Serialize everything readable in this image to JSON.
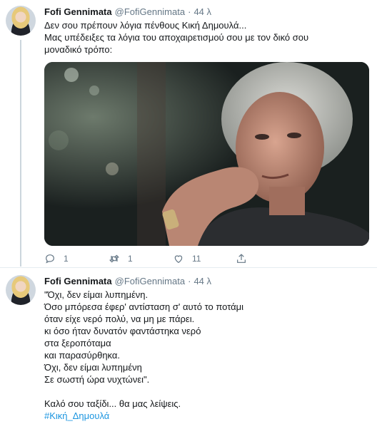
{
  "tweets": [
    {
      "author_name": "Fofi Gennimata",
      "handle": "@FofiGennimata",
      "separator": "·",
      "time": "44 λ",
      "text_lines": [
        "Δεν σου πρέπουν λόγια πένθους Κική Δημουλά...",
        "Μας υπέδειξες τα λόγια του αποχαιρετισμού σου με τον δικό σου",
        "μοναδικό τρόπο:"
      ],
      "actions": {
        "reply_count": "1",
        "retweet_count": "1",
        "like_count": "11"
      }
    },
    {
      "author_name": "Fofi Gennimata",
      "handle": "@FofiGennimata",
      "separator": "·",
      "time": "44 λ",
      "text_lines": [
        "\"Όχι, δεν είμαι λυπημένη.",
        "Όσο μπόρεσα έφερ' αντίσταση σ' αυτό το ποτάμι",
        "όταν είχε νερό πολύ, να μη με πάρει.",
        "κι όσο ήταν δυνατόν φαντάστηκα νερό",
        "στα ξεροπόταμα",
        "και παρασύρθηκα.",
        "Όχι, δεν είμαι λυπημένη",
        "Σε σωστή ώρα νυχτώνει\".",
        "Καλό σου ταξίδι... θα μας λείψεις."
      ],
      "hashtag": "#Κική_Δημουλά"
    }
  ],
  "icons": {
    "reply": "reply-icon",
    "retweet": "retweet-icon",
    "like": "like-icon",
    "share": "share-icon"
  },
  "colors": {
    "link": "#1b95e0",
    "secondary_text": "#657786",
    "thread_line": "#ccd6dd",
    "divider": "#e6ecf0"
  }
}
